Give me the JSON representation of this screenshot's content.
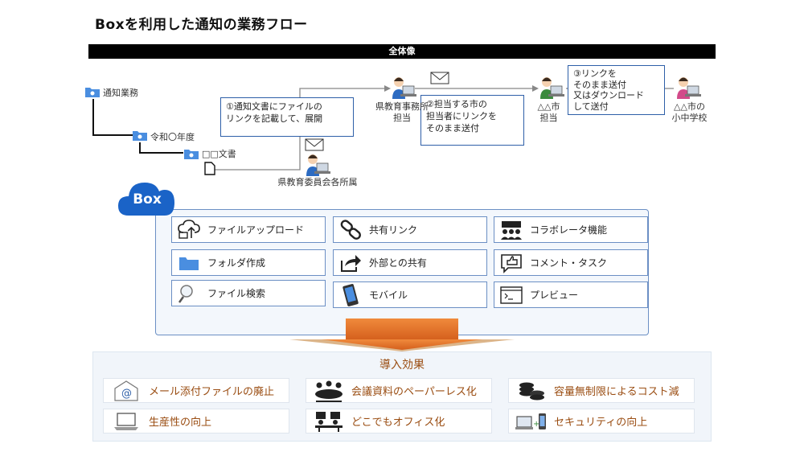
{
  "title": "Boxを利用した通知の業務フロー",
  "banner": "全体像",
  "folders": {
    "root": "通知業務",
    "year": "令和〇年度",
    "doc": "□□文書"
  },
  "callouts": {
    "step1": [
      "①通知文書にファイルの",
      "リンクを記載して、展開"
    ],
    "step2": [
      "②担当する市の",
      "担当者にリンクを",
      "そのまま送付"
    ],
    "step3": [
      "③リンクを",
      "そのまま送付",
      "又はダウンロード",
      "して送付"
    ]
  },
  "people": {
    "pref_office": [
      "県教育事務所",
      "担当"
    ],
    "city": [
      "△△市",
      "担当"
    ],
    "schools": [
      "△△市の",
      "小中学校"
    ],
    "board": "県教育委員会各所属"
  },
  "box_logo": "Box",
  "features": [
    {
      "label": "ファイルアップロード",
      "icon": "cloud-upload-icon"
    },
    {
      "label": "共有リンク",
      "icon": "link-icon"
    },
    {
      "label": "コラボレータ機能",
      "icon": "collaborators-icon"
    },
    {
      "label": "フォルダ作成",
      "icon": "folder-icon"
    },
    {
      "label": "外部との共有",
      "icon": "share-icon"
    },
    {
      "label": "コメント・タスク",
      "icon": "thumbs-up-comment-icon"
    },
    {
      "label": "ファイル検索",
      "icon": "search-icon"
    },
    {
      "label": "モバイル",
      "icon": "mobile-icon"
    },
    {
      "label": "プレビュー",
      "icon": "preview-window-icon"
    }
  ],
  "effect_title": "導入効果",
  "effects": [
    {
      "label": "メール添付ファイルの廃止",
      "icon": "email-icon"
    },
    {
      "label": "会議資料のペーパーレス化",
      "icon": "meeting-icon"
    },
    {
      "label": "容量無制限によるコスト減",
      "icon": "coins-icon"
    },
    {
      "label": "生産性の向上",
      "icon": "laptop-icon"
    },
    {
      "label": "どこでもオフィス化",
      "icon": "remote-office-icon"
    },
    {
      "label": "セキュリティの向上",
      "icon": "security-devices-icon"
    }
  ],
  "colors": {
    "accent_blue": "#2e5fa8",
    "box_blue": "#0061d5",
    "effect_text": "#9a4d12",
    "arrow_orange": "#e8702a"
  }
}
